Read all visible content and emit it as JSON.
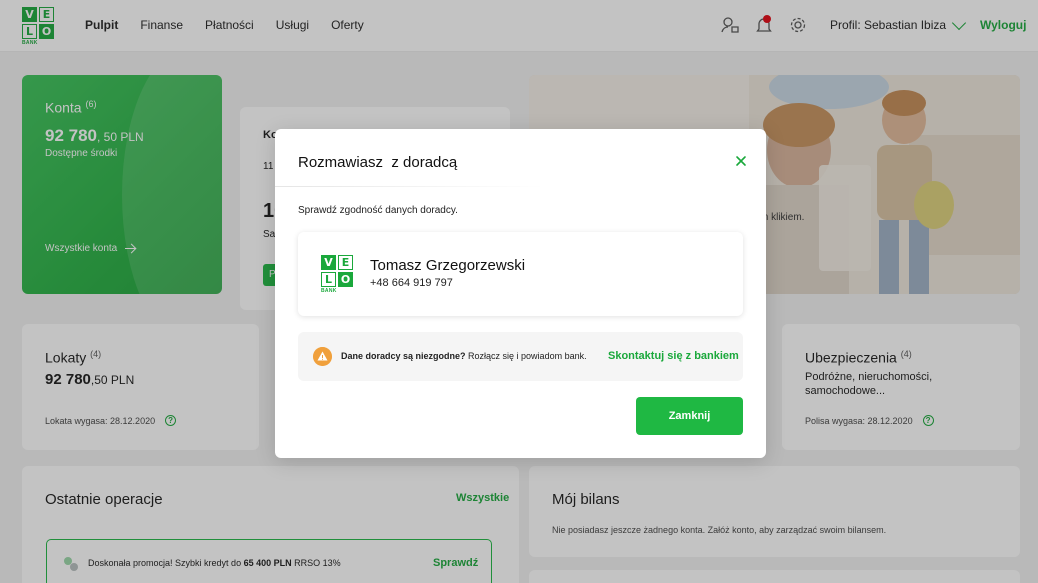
{
  "header": {
    "logo_letters": [
      "V",
      "E",
      "L",
      "O"
    ],
    "logo_bank": "BANK",
    "nav": [
      "Pulpit",
      "Finanse",
      "Płatności",
      "Usługi",
      "Oferty"
    ],
    "profile_label": "Profil: Sebastian Ibiza",
    "logout_label": "Wyloguj",
    "icons": [
      "advisor-icon",
      "bell-icon",
      "gear-icon"
    ],
    "notification_color": "#e30613"
  },
  "accounts": {
    "title": "Konta",
    "count": "(6)",
    "amount_main": "92 780",
    "amount_rest": ", 50 PLN",
    "subtitle": "Dostępne środki",
    "link": "Wszystkie konta",
    "partial_card": {
      "title": "Ko",
      "line": "11 2",
      "big": "10",
      "small": "Sa",
      "button": "P"
    }
  },
  "banner": {
    "text": "m klikiem."
  },
  "deposits": {
    "title": "Lokaty",
    "count": "(4)",
    "amount_main": "92 780",
    "amount_rest": ",50 PLN",
    "note": "Lokata wygasa: 28.12.2020"
  },
  "insurance": {
    "title": "Ubezpieczenia",
    "count": "(4)",
    "desc_line1": "Podróżne, nieruchomości,",
    "desc_line2": "samochodowe...",
    "note": "Polisa wygasa: 28.12.2020"
  },
  "operations": {
    "title": "Ostatnie operacje",
    "link": "Wszystkie",
    "promo_prefix": "Doskonała promocja! Szybki kredyt do ",
    "promo_bold": "65 400 PLN",
    "promo_suffix": " RRSO 13%",
    "promo_link": "Sprawdź"
  },
  "balance": {
    "title": "Mój bilans",
    "text": "Nie posiadasz jeszcze żadnego konta. Załóż konto, aby zarządzać swoim bilansem."
  },
  "modal": {
    "title": "Rozmawiasz  z doradcą",
    "subtitle": "Sprawdź zgodność danych doradcy.",
    "advisor_name": "Tomasz Grzegorzewski",
    "advisor_phone": "+48 664 919 797",
    "warning_bold": "Dane doradcy są niezgodne?",
    "warning_text": " Rozłącz się i powiadom bank.",
    "warning_link": "Skontaktuj się z bankiem",
    "close_button": "Zamknij",
    "accent_color": "#1fb843",
    "warning_color": "#f0a03c"
  }
}
